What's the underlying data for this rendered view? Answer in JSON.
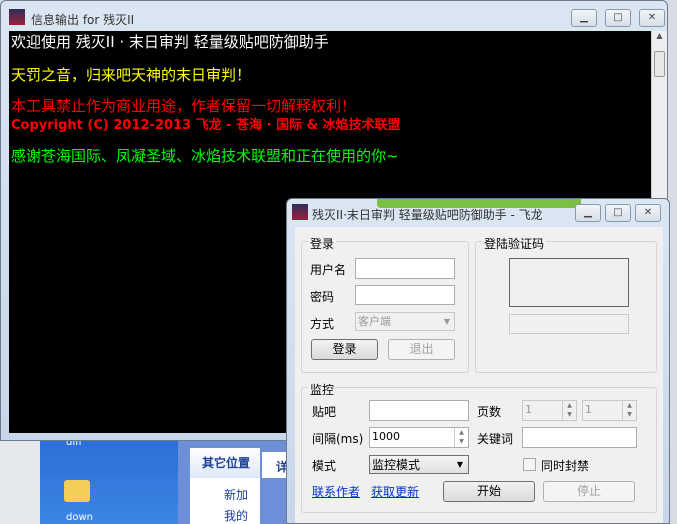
{
  "console_window": {
    "title": "信息输出 for 残灭II",
    "lines": [
      {
        "text": "欢迎使用 残灭II · 末日审判 轻量级贴吧防御助手",
        "color": "#ffffff"
      },
      {
        "text": "天罚之音，归来吧天神的末日审判！",
        "color": "#ffff00"
      },
      {
        "text": "本工具禁止作为商业用途，作者保留一切解释权利！",
        "color": "#ff0000"
      },
      {
        "text": "Copyright (C) 2012-2013 飞龙 - 苍海 · 国际 & 冰焰技术联盟",
        "color": "#ff0000"
      },
      {
        "text": "感谢苍海国际、凤凝圣域、冰焰技术联盟和正在使用的你~",
        "color": "#00ff00"
      }
    ]
  },
  "dialog": {
    "title": "残灭II·末日审判 轻量级贴吧防御助手 - 飞龙",
    "login": {
      "group": "登录",
      "username_label": "用户名",
      "username": "",
      "password_label": "密码",
      "password": "",
      "mode_label": "方式",
      "mode_value": "客户端",
      "login_button": "登录",
      "logout_button": "退出"
    },
    "captcha": {
      "group": "登陆验证码",
      "value": ""
    },
    "monitor": {
      "group": "监控",
      "tieba_label": "贴吧",
      "tieba": "",
      "pages_label": "页数",
      "page_from": "1",
      "page_to": "1",
      "interval_label": "间隔(ms)",
      "interval": "1000",
      "keyword_label": "关键词",
      "keyword": "",
      "mode_label": "模式",
      "mode_value": "监控模式",
      "ban_label": "同时封禁",
      "ban_checked": false,
      "contact_link": "联系作者",
      "update_link": "获取更新",
      "start_button": "开始",
      "stop_button": "停止"
    }
  },
  "desktop": {
    "panel_title": "其它位置",
    "item1": "新加",
    "item2": "我的",
    "icon_label": "down",
    "icon_label_top": "diff",
    "card2": "详"
  },
  "colors": {
    "console_bg": "#000000",
    "accent_bar": "#7ac143"
  }
}
